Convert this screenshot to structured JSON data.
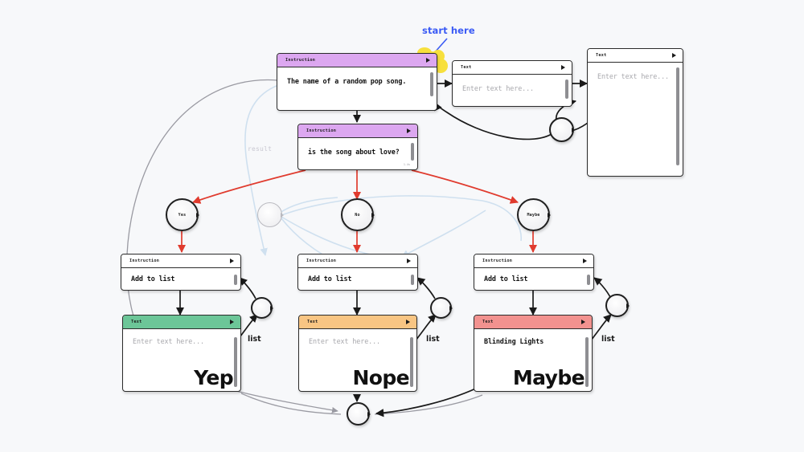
{
  "canvas": {
    "background": "#f7f8fa",
    "accent_blue": "#3b5bf5",
    "highlight_yellow": "#f7e03d",
    "edge_red": "#e03b2e",
    "edge_black": "#1a1a1a",
    "edge_grey": "#9a9aa2",
    "edge_blue": "#cfe0ef"
  },
  "annotations": {
    "start_here": "start here",
    "result": "result",
    "list_1": "list",
    "list_2": "list",
    "list_3": "list"
  },
  "nodes": [
    {
      "id": "instr-song",
      "type": "instruction",
      "header_label": "Instruction",
      "header_color": "#dca7f0",
      "content": "The name of a random pop song.",
      "placeholder": ""
    },
    {
      "id": "text-song-out",
      "type": "text",
      "header_label": "Text",
      "header_color": "#ffffff",
      "content": "",
      "placeholder": "Enter text here..."
    },
    {
      "id": "text-tall-right",
      "type": "text",
      "header_label": "Text",
      "header_color": "#ffffff",
      "content": "",
      "placeholder": "Enter text here..."
    },
    {
      "id": "instr-love",
      "type": "instruction",
      "header_label": "Instruction",
      "header_color": "#dca7f0",
      "content": "is the song about love?",
      "placeholder": "",
      "corner_note": "1.4s"
    },
    {
      "id": "instr-add-yes",
      "type": "instruction",
      "header_label": "Instruction",
      "header_color": "#dca7f0",
      "content": "Add to list",
      "placeholder": ""
    },
    {
      "id": "instr-add-no",
      "type": "instruction",
      "header_label": "Instruction",
      "header_color": "#dca7f0",
      "content": "Add to list",
      "placeholder": ""
    },
    {
      "id": "instr-add-maybe",
      "type": "instruction",
      "header_label": "Instruction",
      "header_color": "#dca7f0",
      "content": "Add to list",
      "placeholder": ""
    },
    {
      "id": "text-yep",
      "type": "text",
      "header_label": "Text",
      "header_color": "#6cc698",
      "content": "",
      "placeholder": "Enter text here...",
      "big_word": "Yep"
    },
    {
      "id": "text-nope",
      "type": "text",
      "header_label": "Text",
      "header_color": "#f8c583",
      "content": "",
      "placeholder": "Enter text here...",
      "big_word": "Nope"
    },
    {
      "id": "text-maybe",
      "type": "text",
      "header_label": "Text",
      "header_color": "#f2928f",
      "content": "Blinding Lights",
      "placeholder": "",
      "big_word": "Maybe"
    }
  ],
  "circles": [
    {
      "id": "circle-yes",
      "label": "Yes",
      "style": "dark"
    },
    {
      "id": "circle-no",
      "label": "No",
      "style": "dark"
    },
    {
      "id": "circle-maybe",
      "label": "Maybe",
      "style": "dark"
    },
    {
      "id": "circle-mid",
      "label": "",
      "style": "light"
    },
    {
      "id": "circle-loop-tr",
      "label": "",
      "style": "dark"
    },
    {
      "id": "circle-join-1",
      "label": "",
      "style": "dark"
    },
    {
      "id": "circle-join-2",
      "label": "",
      "style": "dark"
    },
    {
      "id": "circle-join-3",
      "label": "",
      "style": "dark"
    },
    {
      "id": "circle-bottom",
      "label": "",
      "style": "dark"
    }
  ]
}
